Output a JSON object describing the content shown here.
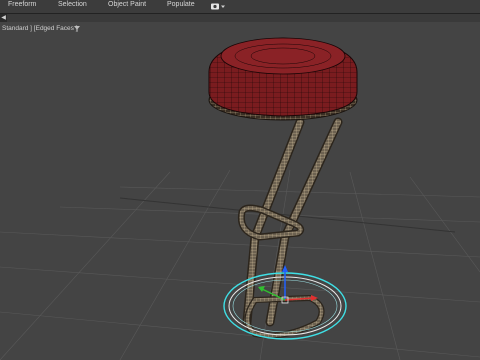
{
  "ribbon": {
    "tabs": [
      "Freeform",
      "Selection",
      "Object Paint",
      "Populate"
    ]
  },
  "viewport": {
    "corner_label": "◀",
    "label": "Standard ] [Edged Faces ]",
    "object": "bar-stool",
    "colors": {
      "background": "#444444",
      "grid": "#5a5a5a",
      "seat_top": "#7a1c1f",
      "seat_wire": "#1a0506",
      "frame": "#b9a47a",
      "selection": "#3fe0e6",
      "gizmo_x": "#e03030",
      "gizmo_y": "#30c030",
      "gizmo_z": "#2060ff"
    }
  }
}
